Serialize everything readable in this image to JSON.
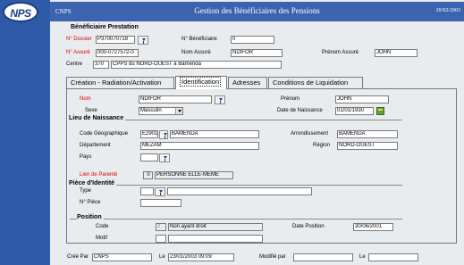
{
  "logo": {
    "text": "NPS"
  },
  "header": {
    "left": "CNPS",
    "title": "Gestion des Bénéficiaires des Pensions",
    "date": "20/02/2003"
  },
  "benef": {
    "section_title": "Bénéficiaire Prestation",
    "dossier_label": "N° Dossier",
    "dossier_value": "P370070718",
    "nbenef_label": "N° Bénéficiaire",
    "nbenef_value": "0",
    "assure_label": "N° Assuré",
    "assure_value": "000-0727572-0",
    "nom_assure_label": "Nom Assuré",
    "nom_assure_value": "NDIFOR",
    "prenom_assure_label": "Prénom Assuré",
    "prenom_assure_value": "JOHN",
    "centre_label": "Centre",
    "centre_code": "370",
    "centre_name": "CPPS du NORD-OUEST à Bamenda"
  },
  "tabs": [
    {
      "label": "Création - Radiation/Activation"
    },
    {
      "label": "Identification"
    },
    {
      "label": "Adresses"
    },
    {
      "label": "Conditions de Liquidation"
    }
  ],
  "ident": {
    "nom_label": "Nom",
    "nom_value": "NDIFOR",
    "prenom_label": "Prénom",
    "prenom_value": "JOHN",
    "sexe_label": "Sexe",
    "sexe_value": "Masculin",
    "dob_label": "Date de Naissance",
    "dob_value": "01/01/1930"
  },
  "lieu": {
    "title": "Lieu de Naissance",
    "code_geo_label": "Code Géographique",
    "code_geo_value": "E2901",
    "ville_value": "BAMENDA",
    "arr_label": "Arrondissement",
    "arr_value": "BAMENDA",
    "dept_label": "Département",
    "dept_value": "MEZAM",
    "region_label": "Région",
    "region_value": "NORD-OUEST",
    "pays_label": "Pays",
    "pays_value": ""
  },
  "parente": {
    "label": "Lien de Parenté",
    "code": "0",
    "value": "PERSONNE ELLE-MÊME"
  },
  "piece": {
    "title": "Pièce d'Identité",
    "type_label": "Type",
    "type_value": "",
    "num_label": "N° Pièce",
    "num_value": ""
  },
  "position": {
    "title": "Position",
    "code_label": "Code",
    "code_value": "2",
    "code_desc": "Non ayant droit",
    "date_label": "Date Position",
    "date_value": "30/06/2001",
    "motif_label": "Motif",
    "motif_code": "",
    "motif_desc": ""
  },
  "footer": {
    "cree_label": "Créé Par",
    "cree_value": "CNPS",
    "le_label": "Le",
    "le_value": "23/01/2003 09:09",
    "modif_label": "Modifié par",
    "modif_value": "",
    "le2_label": "Le",
    "le2_value": ""
  }
}
